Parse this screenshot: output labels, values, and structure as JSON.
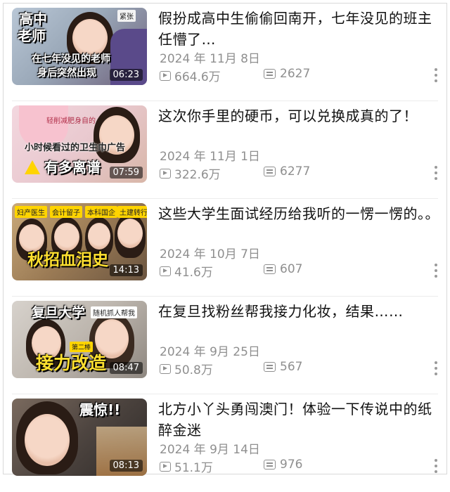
{
  "videos": [
    {
      "title": "假扮成高中生偷偷回南开，七年没见的班主任懵了…",
      "date": "2024 年 11月 8日",
      "views": "664.6万",
      "comments": "2627",
      "duration": "06:23",
      "thumb_text": [
        "高中",
        "老师",
        "紧张",
        "在七年没见的老师",
        "身后突然出现"
      ]
    },
    {
      "title": "这次你手里的硬币，可以兑换成真的了！",
      "date": "2024 年 11月 1日",
      "views": "322.6万",
      "comments": "6277",
      "duration": "07:59",
      "thumb_text": [
        "小时候看过的卫生巾广告",
        "有多离谱",
        "轻削减肥身自的"
      ]
    },
    {
      "title": "这些大学生面试经历给我听的一愣一愣的。。",
      "date": "2024 年 10月 7日",
      "views": "41.6万",
      "comments": "607",
      "duration": "14:13",
      "thumb_text": [
        "妇产医生",
        "会计留子",
        "本科国企",
        "土建转行",
        "秋招血泪史"
      ]
    },
    {
      "title": "在复旦找粉丝帮我接力化妆，结果……",
      "date": "2024 年 9月 25日",
      "views": "50.8万",
      "comments": "567",
      "duration": "08:47",
      "thumb_text": [
        "复旦大学",
        "随机抓人帮我",
        "接力改造",
        "第二棒"
      ]
    },
    {
      "title": "北方小丫头勇闯澳门！体验一下传说中的纸醉金迷",
      "date": "2024 年 9月 14日",
      "views": "51.1万",
      "comments": "976",
      "duration": "08:13",
      "thumb_text": [
        "震惊!!"
      ]
    }
  ]
}
